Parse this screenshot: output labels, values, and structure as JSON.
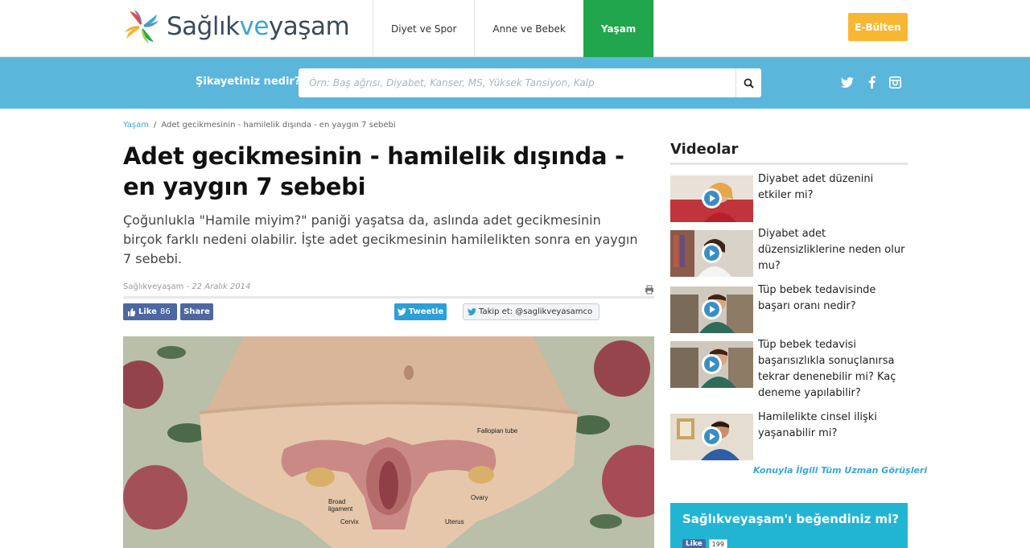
{
  "header": {
    "logo_main": "Sağlık",
    "logo_ve": "ve",
    "logo_end": "yaşam",
    "nav": [
      {
        "label": "Diyet ve Spor"
      },
      {
        "label": "Anne ve Bebek"
      },
      {
        "label": "Yaşam"
      }
    ],
    "ebulten_label": "E-Bülten",
    "accent_green": "#21a54d",
    "accent_blue": "#5bb6dc",
    "accent_orange": "#f8b733"
  },
  "search": {
    "label": "Şikayetiniz nedir?",
    "placeholder": "Örn: Baş ağrısı, Diyabet, Kanser, MS, Yüksek Tansiyon, Kalp",
    "button_icon": "search-icon"
  },
  "social_icons": [
    "twitter-icon",
    "facebook-icon",
    "instagram-icon"
  ],
  "breadcrumb": {
    "section": "Yaşam",
    "separator": "/",
    "current": "Adet gecikmesinin - hamilelik dışında - en yaygın 7 sebebi"
  },
  "article": {
    "title": "Adet gecikmesinin - hamilelik dışında - en yaygın 7 sebebi",
    "lead": "Çoğunlukla \"Hamile miyim?\" paniği yaşatsa da, aslında adet gecikmesinin birçok farklı nedeni olabilir. İşte adet gecikmesinin hamilelikten sonra en yaygın 7 sebebi.",
    "author": "Sağlıkveyaşam",
    "date": "22 Aralık 2014",
    "share": {
      "like_label": "Like",
      "like_count": "86",
      "share_label": "Share",
      "tweet_label": "Tweetle",
      "follow_label": "Takip et: @saglikveyasamco"
    },
    "image_labels": {
      "fallopian": "Fallopian tube",
      "broad": "Broad",
      "ligament": "ligament",
      "ovary": "Ovary",
      "cervix": "Cervix",
      "uterus": "Uterus"
    }
  },
  "sidebar": {
    "heading": "Videolar",
    "videos": [
      {
        "title": "Diyabet adet düzenini etkiler mi?"
      },
      {
        "title": "Diyabet adet düzensizliklerine neden olur mu?"
      },
      {
        "title": "Tüp bebek tedavisinde başarı oranı nedir?"
      },
      {
        "title": "Tüp bebek tedavisi başarısızlıkla sonuçlanırsa tekrar denenebilir mi? Kaç deneme yapılabilir?"
      },
      {
        "title": "Hamilelikte cinsel ilişki yaşanabilir mi?"
      }
    ],
    "all_link": "Konuyla İlgili Tüm Uzman Görüşleri",
    "like_box": {
      "title": "Sağlıkveyaşam'ı beğendiniz mi?",
      "like_label": "Like",
      "like_count": "199"
    }
  }
}
